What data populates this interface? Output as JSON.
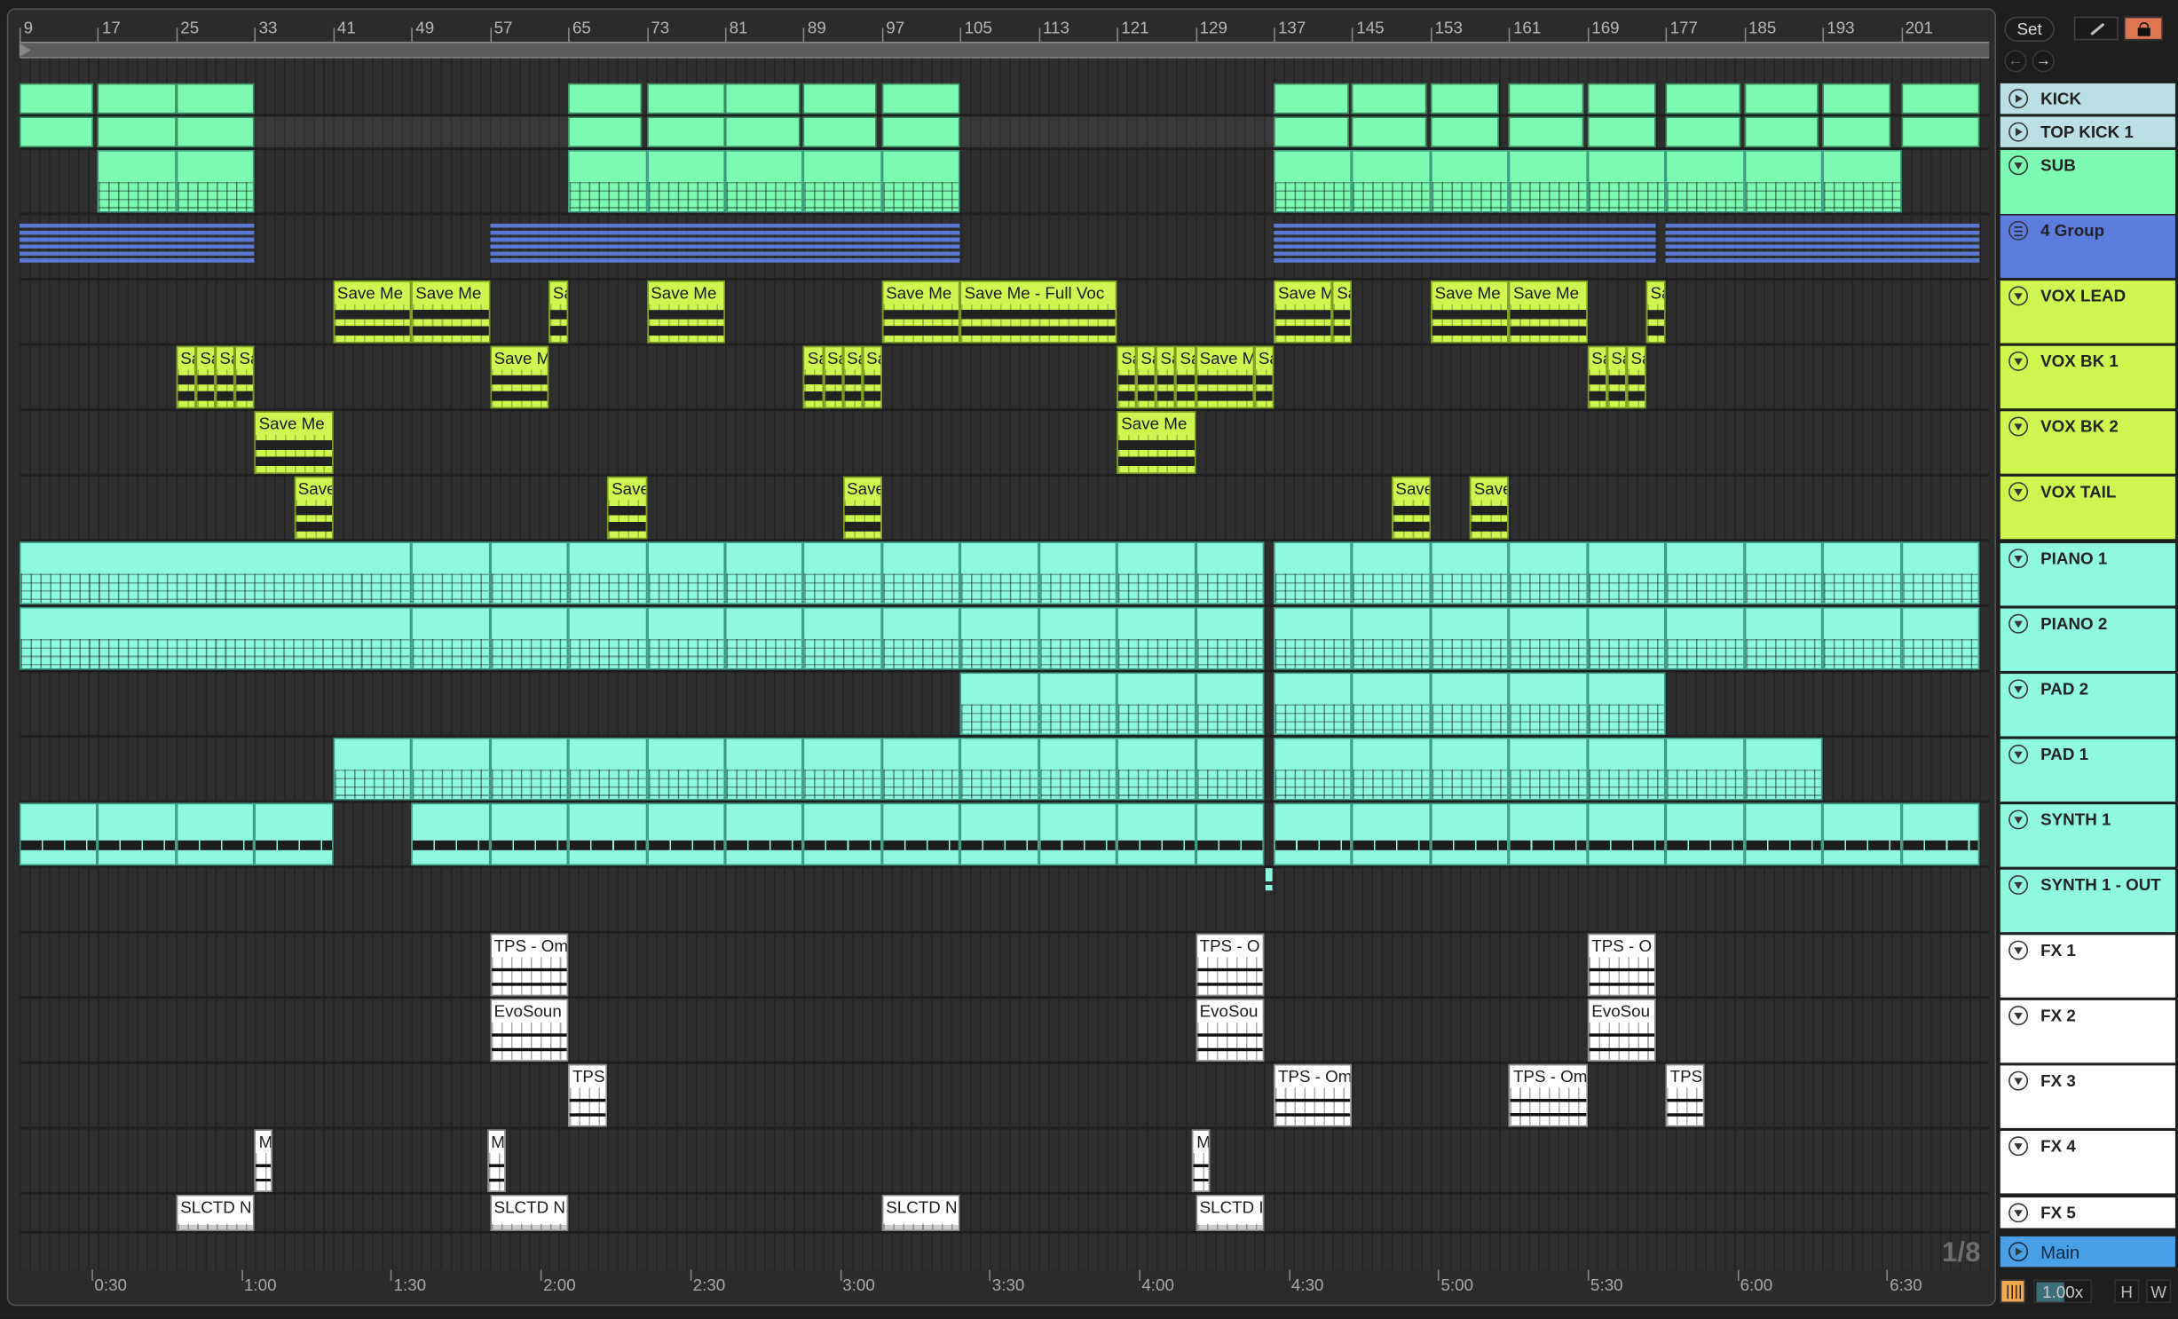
{
  "ruler": {
    "bars": [
      "9",
      "17",
      "25",
      "33",
      "41",
      "49",
      "57",
      "65",
      "73",
      "81",
      "89",
      "97",
      "105",
      "113",
      "121",
      "129",
      "137",
      "145",
      "153",
      "161",
      "169",
      "177",
      "185",
      "193",
      "201"
    ]
  },
  "timeline": {
    "labels": [
      "0:30",
      "1:00",
      "1:30",
      "2:00",
      "2:30",
      "3:00",
      "3:30",
      "4:00",
      "4:30",
      "5:00",
      "5:30",
      "6:00",
      "6:30"
    ],
    "seconds": [
      30,
      60,
      90,
      120,
      150,
      180,
      210,
      240,
      270,
      300,
      330,
      360,
      390
    ]
  },
  "controls": {
    "set_label": "Set",
    "zoom_value": "1.00x",
    "h_label": "H",
    "w_label": "W",
    "grid_label": "1/8"
  },
  "colors": {
    "kick_header": "#b9dfe7",
    "green": "#7cfab1",
    "blue": "#5b7ddd",
    "lime": "#cdf64f",
    "cyan": "#8ef8e1",
    "white": "#ffffff",
    "main": "#49a0e6",
    "lock": "#e07650",
    "orange": "#f2a94e"
  },
  "tracks": [
    {
      "name": "KICK",
      "icon": "play",
      "kind": "solid",
      "color": "#7cfab1",
      "header_color": "#b9dfe7",
      "clips": [
        [
          9,
          16.5
        ],
        [
          17,
          25
        ],
        [
          25,
          33
        ],
        [
          65,
          72.5
        ],
        [
          73,
          81
        ],
        [
          81,
          88.6
        ],
        [
          89,
          96.5
        ],
        [
          97,
          105
        ],
        [
          137,
          144.7
        ],
        [
          145,
          152.6
        ],
        [
          153,
          160
        ],
        [
          161,
          168.6
        ],
        [
          169,
          176
        ],
        [
          177,
          184.6
        ],
        [
          185,
          192.5
        ],
        [
          193,
          200
        ],
        [
          201,
          209
        ]
      ]
    },
    {
      "name": "TOP KICK 1",
      "icon": "play",
      "kind": "solid",
      "color": "#7cfab1",
      "header_color": "#b9dfe7",
      "clips": [
        [
          9,
          16.5
        ],
        [
          17,
          25
        ],
        [
          25,
          33
        ],
        [
          65,
          72.5
        ],
        [
          73,
          81
        ],
        [
          81,
          88.6
        ],
        [
          89,
          96.5
        ],
        [
          97,
          105
        ],
        [
          137,
          144.7
        ],
        [
          145,
          152.6
        ],
        [
          153,
          160
        ],
        [
          161,
          168.6
        ],
        [
          169,
          176
        ],
        [
          177,
          184.6
        ],
        [
          185,
          192.5
        ],
        [
          193,
          200
        ],
        [
          201,
          209
        ]
      ]
    },
    {
      "name": "SUB",
      "icon": "down",
      "kind": "midi",
      "color": "#7cfab1",
      "header_color": "#7cfab1",
      "clips": [
        [
          17,
          25
        ],
        [
          25,
          33
        ],
        [
          65,
          73
        ],
        [
          73,
          81
        ],
        [
          81,
          89
        ],
        [
          89,
          97
        ],
        [
          97,
          105
        ],
        [
          137,
          145
        ],
        [
          145,
          153
        ],
        [
          153,
          161
        ],
        [
          161,
          169
        ],
        [
          169,
          177
        ],
        [
          177,
          185
        ],
        [
          185,
          193
        ],
        [
          193,
          201
        ]
      ]
    },
    {
      "name": "4 Group",
      "icon": "group",
      "kind": "group",
      "color": "#5b7ddd",
      "header_color": "#5b7ddd",
      "clips": [
        [
          9,
          33
        ],
        [
          57,
          105
        ],
        [
          137,
          176
        ],
        [
          177,
          209
        ]
      ]
    },
    {
      "name": "VOX LEAD",
      "icon": "down",
      "kind": "audio",
      "color": "#cdf64f",
      "header_color": "#cdf64f",
      "clips": [
        [
          41,
          49,
          "Save Me"
        ],
        [
          49,
          57,
          "Save Me"
        ],
        [
          63,
          65,
          "Sa"
        ],
        [
          73,
          81,
          "Save Me"
        ],
        [
          97,
          105,
          "Save Me"
        ],
        [
          105,
          121,
          "Save Me - Full Voc"
        ],
        [
          137,
          143,
          "Save M"
        ],
        [
          143,
          145,
          "Sa"
        ],
        [
          153,
          161,
          "Save Me"
        ],
        [
          161,
          169,
          "Save Me"
        ],
        [
          175,
          177,
          "Sa"
        ]
      ]
    },
    {
      "name": "VOX BK 1",
      "icon": "down",
      "kind": "audio",
      "color": "#cdf64f",
      "header_color": "#cdf64f",
      "clips": [
        [
          25,
          27,
          "Sa"
        ],
        [
          27,
          29,
          "Sa"
        ],
        [
          29,
          31,
          "Sa"
        ],
        [
          31,
          33,
          "Sa"
        ],
        [
          57,
          63,
          "Save M"
        ],
        [
          89,
          91,
          "Sa"
        ],
        [
          91,
          93,
          "Sa"
        ],
        [
          93,
          95,
          "Sa"
        ],
        [
          95,
          97,
          "Sa"
        ],
        [
          121,
          123,
          "Sa"
        ],
        [
          123,
          125,
          "Sa"
        ],
        [
          125,
          127,
          "Sa"
        ],
        [
          127,
          129,
          "Sa"
        ],
        [
          129,
          135,
          "Save M"
        ],
        [
          135,
          137,
          "Sa"
        ],
        [
          169,
          171,
          "Sa"
        ],
        [
          171,
          173,
          "Sa"
        ],
        [
          173,
          175,
          "Sa"
        ]
      ]
    },
    {
      "name": "VOX BK 2",
      "icon": "down",
      "kind": "audio",
      "color": "#cdf64f",
      "header_color": "#cdf64f",
      "clips": [
        [
          33,
          41,
          "Save Me"
        ],
        [
          121,
          129,
          "Save Me"
        ]
      ]
    },
    {
      "name": "VOX TAIL",
      "icon": "down",
      "kind": "audio",
      "color": "#cdf64f",
      "header_color": "#cdf64f",
      "clips": [
        [
          37,
          41,
          "Save"
        ],
        [
          69,
          73,
          "Save"
        ],
        [
          93,
          97,
          "Save"
        ],
        [
          149,
          153,
          "Save"
        ],
        [
          157,
          161,
          "Save"
        ]
      ]
    },
    {
      "name": "PIANO 1",
      "icon": "down",
      "kind": "midi",
      "color": "#8ef8e1",
      "header_color": "#8ef8e1",
      "clips": [
        [
          9,
          49
        ],
        [
          49,
          57
        ],
        [
          57,
          65
        ],
        [
          65,
          73
        ],
        [
          73,
          81
        ],
        [
          81,
          89
        ],
        [
          89,
          97
        ],
        [
          97,
          105
        ],
        [
          105,
          113
        ],
        [
          113,
          121
        ],
        [
          121,
          129
        ],
        [
          129,
          136
        ],
        [
          137,
          145
        ],
        [
          145,
          153
        ],
        [
          153,
          161
        ],
        [
          161,
          169
        ],
        [
          169,
          177
        ],
        [
          177,
          185
        ],
        [
          185,
          193
        ],
        [
          193,
          201
        ],
        [
          201,
          209
        ]
      ]
    },
    {
      "name": "PIANO 2",
      "icon": "down",
      "kind": "midi",
      "color": "#8ef8e1",
      "header_color": "#8ef8e1",
      "clips": [
        [
          9,
          49
        ],
        [
          49,
          57
        ],
        [
          57,
          65
        ],
        [
          65,
          73
        ],
        [
          73,
          81
        ],
        [
          81,
          89
        ],
        [
          89,
          97
        ],
        [
          97,
          105
        ],
        [
          105,
          113
        ],
        [
          113,
          121
        ],
        [
          121,
          129
        ],
        [
          129,
          136
        ],
        [
          137,
          145
        ],
        [
          145,
          153
        ],
        [
          153,
          161
        ],
        [
          161,
          169
        ],
        [
          169,
          177
        ],
        [
          177,
          185
        ],
        [
          185,
          193
        ],
        [
          193,
          201
        ],
        [
          201,
          209
        ]
      ]
    },
    {
      "name": "PAD 2",
      "icon": "down",
      "kind": "midi",
      "color": "#8ef8e1",
      "header_color": "#8ef8e1",
      "clips": [
        [
          105,
          113
        ],
        [
          113,
          121
        ],
        [
          121,
          129
        ],
        [
          129,
          136
        ],
        [
          137,
          145
        ],
        [
          145,
          153
        ],
        [
          153,
          161
        ],
        [
          161,
          169
        ],
        [
          169,
          177
        ]
      ]
    },
    {
      "name": "PAD 1",
      "icon": "down",
      "kind": "midi",
      "color": "#8ef8e1",
      "header_color": "#8ef8e1",
      "clips": [
        [
          41,
          49
        ],
        [
          49,
          57
        ],
        [
          57,
          65
        ],
        [
          65,
          73
        ],
        [
          73,
          81
        ],
        [
          81,
          89
        ],
        [
          89,
          97
        ],
        [
          97,
          105
        ],
        [
          105,
          113
        ],
        [
          113,
          121
        ],
        [
          121,
          129
        ],
        [
          129,
          136
        ],
        [
          137,
          145
        ],
        [
          145,
          153
        ],
        [
          153,
          161
        ],
        [
          161,
          169
        ],
        [
          169,
          177
        ],
        [
          177,
          185
        ],
        [
          185,
          193
        ]
      ]
    },
    {
      "name": "SYNTH 1",
      "icon": "down",
      "kind": "synth",
      "color": "#8ef8e1",
      "header_color": "#8ef8e1",
      "clips": [
        [
          9,
          17
        ],
        [
          17,
          25
        ],
        [
          25,
          33
        ],
        [
          33,
          41
        ],
        [
          49,
          57
        ],
        [
          57,
          65
        ],
        [
          65,
          73
        ],
        [
          73,
          81
        ],
        [
          81,
          89
        ],
        [
          89,
          97
        ],
        [
          97,
          105
        ],
        [
          105,
          113
        ],
        [
          113,
          121
        ],
        [
          121,
          129
        ],
        [
          129,
          136
        ],
        [
          137,
          145
        ],
        [
          145,
          153
        ],
        [
          153,
          161
        ],
        [
          161,
          169
        ],
        [
          169,
          177
        ],
        [
          177,
          185
        ],
        [
          185,
          193
        ],
        [
          193,
          201
        ],
        [
          201,
          209
        ]
      ]
    },
    {
      "name": "SYNTH 1 - OUT",
      "icon": "down",
      "kind": "solid-small",
      "color": "#8ef8e1",
      "header_color": "#8ef8e1",
      "clips": [
        [
          136.1,
          136.8
        ]
      ]
    },
    {
      "name": "FX 1",
      "icon": "down",
      "kind": "fx",
      "color": "#ffffff",
      "header_color": "#ffffff",
      "clips": [
        [
          57,
          65,
          "TPS - Om"
        ],
        [
          129,
          136,
          "TPS - O"
        ],
        [
          169,
          176,
          "TPS - O"
        ]
      ]
    },
    {
      "name": "FX 2",
      "icon": "down",
      "kind": "fx",
      "color": "#ffffff",
      "header_color": "#ffffff",
      "clips": [
        [
          57,
          65,
          "EvoSoun"
        ],
        [
          129,
          136,
          "EvoSou"
        ],
        [
          169,
          176,
          "EvoSou"
        ]
      ]
    },
    {
      "name": "FX 3",
      "icon": "down",
      "kind": "fx",
      "color": "#ffffff",
      "header_color": "#ffffff",
      "clips": [
        [
          65,
          69,
          "TPS"
        ],
        [
          137,
          145,
          "TPS - Om"
        ],
        [
          161,
          169,
          "TPS - Om"
        ],
        [
          177,
          181,
          "TPS"
        ]
      ]
    },
    {
      "name": "FX 4",
      "icon": "down",
      "kind": "fx",
      "color": "#ffffff",
      "header_color": "#ffffff",
      "clips": [
        [
          33,
          34.8,
          "M"
        ],
        [
          56.7,
          58.6,
          "M"
        ],
        [
          128.7,
          130.5,
          "M"
        ]
      ]
    },
    {
      "name": "FX 5",
      "icon": "down",
      "kind": "fx-short",
      "color": "#ffffff",
      "header_color": "#ffffff",
      "clips": [
        [
          25,
          33,
          "SLCTD N"
        ],
        [
          57,
          65,
          "SLCTD N"
        ],
        [
          97,
          105,
          "SLCTD N"
        ],
        [
          129,
          136,
          "SLCTD I"
        ]
      ]
    },
    {
      "name": "Main",
      "icon": "play",
      "kind": "none",
      "color": "#49a0e6",
      "header_color": "#49a0e6",
      "clips": []
    }
  ]
}
